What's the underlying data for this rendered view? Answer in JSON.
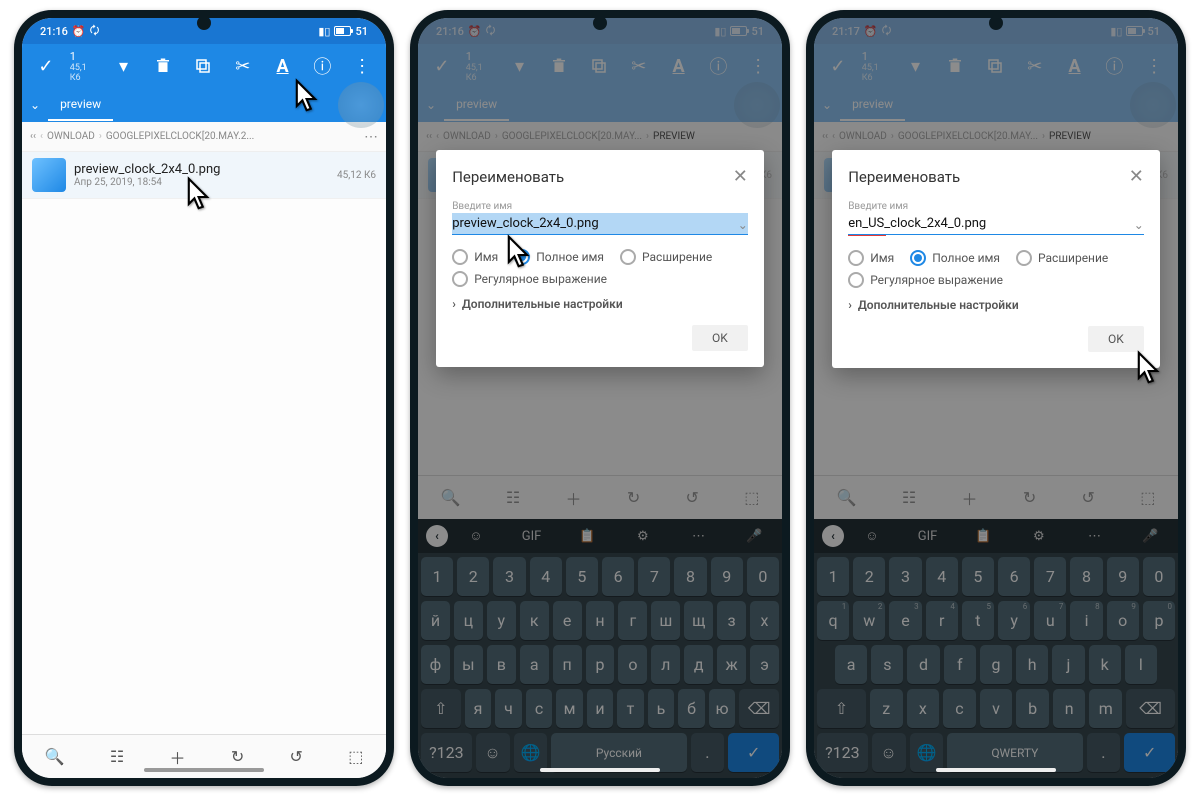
{
  "status": {
    "t1": "21:16",
    "t2": "21:16",
    "t3": "21:17",
    "bat": "51"
  },
  "appbar": {
    "count": "1",
    "size": "45,1  К6"
  },
  "tab": "preview",
  "bc": {
    "b1": "OWNLOAD",
    "b2": "GOOGLEPIXELCLOCK[20.MAY.2...",
    "b2b": "GOOGLEPIXELCLOCK[20.MAY...",
    "b3": "PREVIEW"
  },
  "file": {
    "name": "preview_clock_2x4_0.png",
    "date": "Апр 25, 2019, 18:54",
    "size": "45,12  К6"
  },
  "dlg": {
    "title": "Переименовать",
    "label": "Введите имя",
    "val1": "preview_clock_2x4_0.png",
    "val2": "en_US_clock_2x4_0.png",
    "opt1": "Имя",
    "opt2": "Полное имя",
    "opt3": "Расширение",
    "opt4": "Регулярное выражение",
    "more": "Дополнительные настройки",
    "ok": "OK"
  },
  "kb": {
    "gif": "GIF",
    "r1": [
      "1",
      "2",
      "3",
      "4",
      "5",
      "6",
      "7",
      "8",
      "9",
      "0"
    ],
    "ru2": [
      "й",
      "ц",
      "у",
      "к",
      "е",
      "н",
      "г",
      "ш",
      "щ",
      "з",
      "х"
    ],
    "ru3": [
      "ф",
      "ы",
      "в",
      "а",
      "п",
      "р",
      "о",
      "л",
      "д",
      "ж",
      "э"
    ],
    "ru4": [
      "я",
      "ч",
      "с",
      "м",
      "и",
      "т",
      "ь",
      "б",
      "ю"
    ],
    "en2": [
      "q",
      "w",
      "e",
      "r",
      "t",
      "y",
      "u",
      "i",
      "o",
      "p"
    ],
    "en3": [
      "a",
      "s",
      "d",
      "f",
      "g",
      "h",
      "j",
      "k",
      "l"
    ],
    "en4": [
      "z",
      "x",
      "c",
      "v",
      "b",
      "n",
      "m"
    ],
    "sym": "?123",
    "space_ru": "Русский",
    "space_en": "QWERTY"
  }
}
